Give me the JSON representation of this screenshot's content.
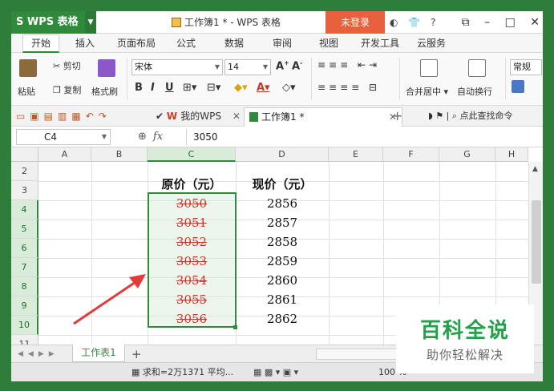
{
  "app": {
    "brand": "WPS 表格",
    "window_title": "工作簿1 * - WPS 表格",
    "login_label": "未登录",
    "help_label": "?"
  },
  "menu": {
    "items": [
      "开始",
      "插入",
      "页面布局",
      "公式",
      "数据",
      "审阅",
      "视图",
      "开发工具",
      "云服务"
    ]
  },
  "ribbon": {
    "paste": "粘贴",
    "cut": "剪切",
    "copy": "复制",
    "format_painter": "格式刷",
    "font_name": "宋体",
    "font_size": "14",
    "merge_center": "合并居中",
    "wrap_text": "自动换行",
    "number_format": "常规"
  },
  "tabs": {
    "wps_tab": "我的WPS",
    "doc_tab": "工作簿1 *",
    "find_command": "点此查找命令"
  },
  "formula_bar": {
    "cell_ref": "C4",
    "fx": "fx",
    "value": "3050"
  },
  "sheet": {
    "columns": [
      "A",
      "B",
      "C",
      "D",
      "E",
      "F",
      "G",
      "H"
    ],
    "rows": [
      "2",
      "3",
      "4",
      "5",
      "6",
      "7",
      "8",
      "9",
      "10",
      "11"
    ],
    "header_orig": "原价（元）",
    "header_now": "现价（元）",
    "original_prices": [
      "3050",
      "3051",
      "3052",
      "3053",
      "3054",
      "3055",
      "3056"
    ],
    "current_prices": [
      "2856",
      "2857",
      "2858",
      "2859",
      "2860",
      "2861",
      "2862"
    ]
  },
  "sheet_tabs": {
    "active": "工作表1",
    "add": "+"
  },
  "status": {
    "sum_text": "求和=2万1371  平均...",
    "zoom": "100 %"
  },
  "watermark": {
    "title": "百科全说",
    "subtitle": "助你轻松解决"
  },
  "colors": {
    "accent": "#2f8a3c",
    "strike": "#c0392b",
    "arrow": "#e23b3b"
  }
}
